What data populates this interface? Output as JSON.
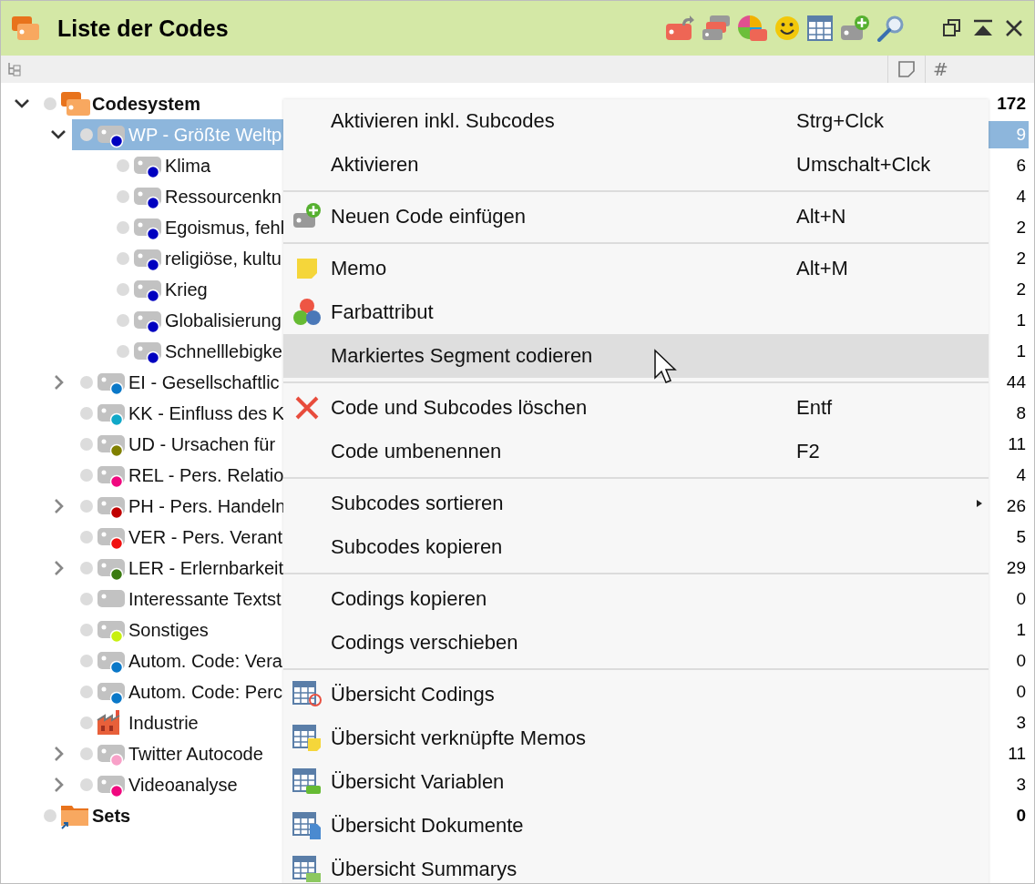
{
  "window": {
    "title": "Liste der Codes"
  },
  "columns": {
    "count_header": "#"
  },
  "tree": [
    {
      "label": "Codesystem",
      "count": "172",
      "kind": "root",
      "expanded": true,
      "selected": false,
      "children": [
        {
          "label": "WP - Größte Weltp",
          "count": "9",
          "kind": "code",
          "color": "#0000c0",
          "expanded": true,
          "selected": true,
          "children": [
            {
              "label": "Klima",
              "count": "6",
              "kind": "code",
              "color": "#0000c0",
              "selected": false
            },
            {
              "label": "Ressourcenkn",
              "count": "4",
              "kind": "code",
              "color": "#0000c0",
              "selected": false
            },
            {
              "label": "Egoismus, fehl",
              "count": "2",
              "kind": "code",
              "color": "#0000c0",
              "selected": false
            },
            {
              "label": "religiöse, kultu",
              "count": "2",
              "kind": "code",
              "color": "#0000c0",
              "selected": false
            },
            {
              "label": "Krieg",
              "count": "2",
              "kind": "code",
              "color": "#0000c0",
              "selected": false
            },
            {
              "label": "Globalisierung",
              "count": "1",
              "kind": "code",
              "color": "#0000c0",
              "selected": false
            },
            {
              "label": "Schnelllebigke",
              "count": "1",
              "kind": "code",
              "color": "#0000c0",
              "selected": false
            }
          ]
        },
        {
          "label": "EI - Gesellschaftlic",
          "count": "44",
          "kind": "code",
          "color": "#0a78c8",
          "expanded": false,
          "selected": false
        },
        {
          "label": "KK - Einfluss des K",
          "count": "8",
          "kind": "code",
          "color": "#10a8c8",
          "selected": false
        },
        {
          "label": "UD - Ursachen für",
          "count": "11",
          "kind": "code",
          "color": "#808000",
          "selected": false
        },
        {
          "label": "REL - Pers. Relatio",
          "count": "4",
          "kind": "code",
          "color": "#f0087f",
          "selected": false
        },
        {
          "label": "PH - Pers. Handeln",
          "count": "26",
          "kind": "code",
          "color": "#c00000",
          "expanded": false,
          "selected": false
        },
        {
          "label": "VER - Pers. Verant",
          "count": "5",
          "kind": "code",
          "color": "#f01010",
          "selected": false
        },
        {
          "label": "LER - Erlernbarkeit",
          "count": "29",
          "kind": "code",
          "color": "#3a7a10",
          "expanded": false,
          "selected": false
        },
        {
          "label": "Interessante Textst",
          "count": "0",
          "kind": "code",
          "selected": false
        },
        {
          "label": "Sonstiges",
          "count": "1",
          "kind": "code",
          "color": "#c8f010",
          "selected": false
        },
        {
          "label": "Autom. Code: Vera",
          "count": "0",
          "kind": "code",
          "color": "#0a78c8",
          "selected": false
        },
        {
          "label": "Autom. Code: Perc",
          "count": "0",
          "kind": "code",
          "color": "#0a78c8",
          "selected": false
        },
        {
          "label": "Industrie",
          "count": "3",
          "kind": "factory",
          "selected": false
        },
        {
          "label": "Twitter Autocode",
          "count": "11",
          "kind": "code",
          "color": "#f8a0c8",
          "expanded": false,
          "selected": false
        },
        {
          "label": "Videoanalyse",
          "count": "3",
          "kind": "code",
          "color": "#f0087f",
          "expanded": false,
          "selected": false
        }
      ]
    },
    {
      "label": "Sets",
      "count": "0",
      "kind": "set",
      "selected": false
    }
  ],
  "context_menu": [
    [
      {
        "label": "Aktivieren inkl. Subcodes",
        "shortcut": "Strg+Clck",
        "selected": false
      },
      {
        "label": "Aktivieren",
        "shortcut": "Umschalt+Clck",
        "selected": false
      }
    ],
    [
      {
        "label": "Neuen Code einfügen",
        "shortcut": "Alt+N",
        "kind": "tag-plus",
        "selected": false
      }
    ],
    [
      {
        "label": "Memo",
        "shortcut": "Alt+M",
        "kind": "memo",
        "selected": false
      },
      {
        "label": "Farbattribut",
        "kind": "colors",
        "selected": false
      },
      {
        "label": "Markiertes Segment codieren",
        "selected": true
      }
    ],
    [
      {
        "label": "Code und Subcodes löschen",
        "shortcut": "Entf",
        "kind": "cross",
        "selected": false
      },
      {
        "label": "Code umbenennen",
        "shortcut": "F2",
        "selected": false
      }
    ],
    [
      {
        "label": "Subcodes sortieren",
        "submenu": true,
        "selected": false
      },
      {
        "label": "Subcodes kopieren",
        "selected": false
      }
    ],
    [
      {
        "label": "Codings kopieren",
        "selected": false
      },
      {
        "label": "Codings verschieben",
        "selected": false
      }
    ],
    [
      {
        "label": "Übersicht Codings",
        "kind": "table-codings",
        "selected": false
      },
      {
        "label": "Übersicht verknüpfte Memos",
        "kind": "table-memo",
        "selected": false
      },
      {
        "label": "Übersicht Variablen",
        "kind": "table-var",
        "selected": false
      },
      {
        "label": "Übersicht Dokumente",
        "kind": "table-doc",
        "selected": false
      },
      {
        "label": "Übersicht Summarys",
        "kind": "table-sum",
        "selected": false
      }
    ]
  ]
}
